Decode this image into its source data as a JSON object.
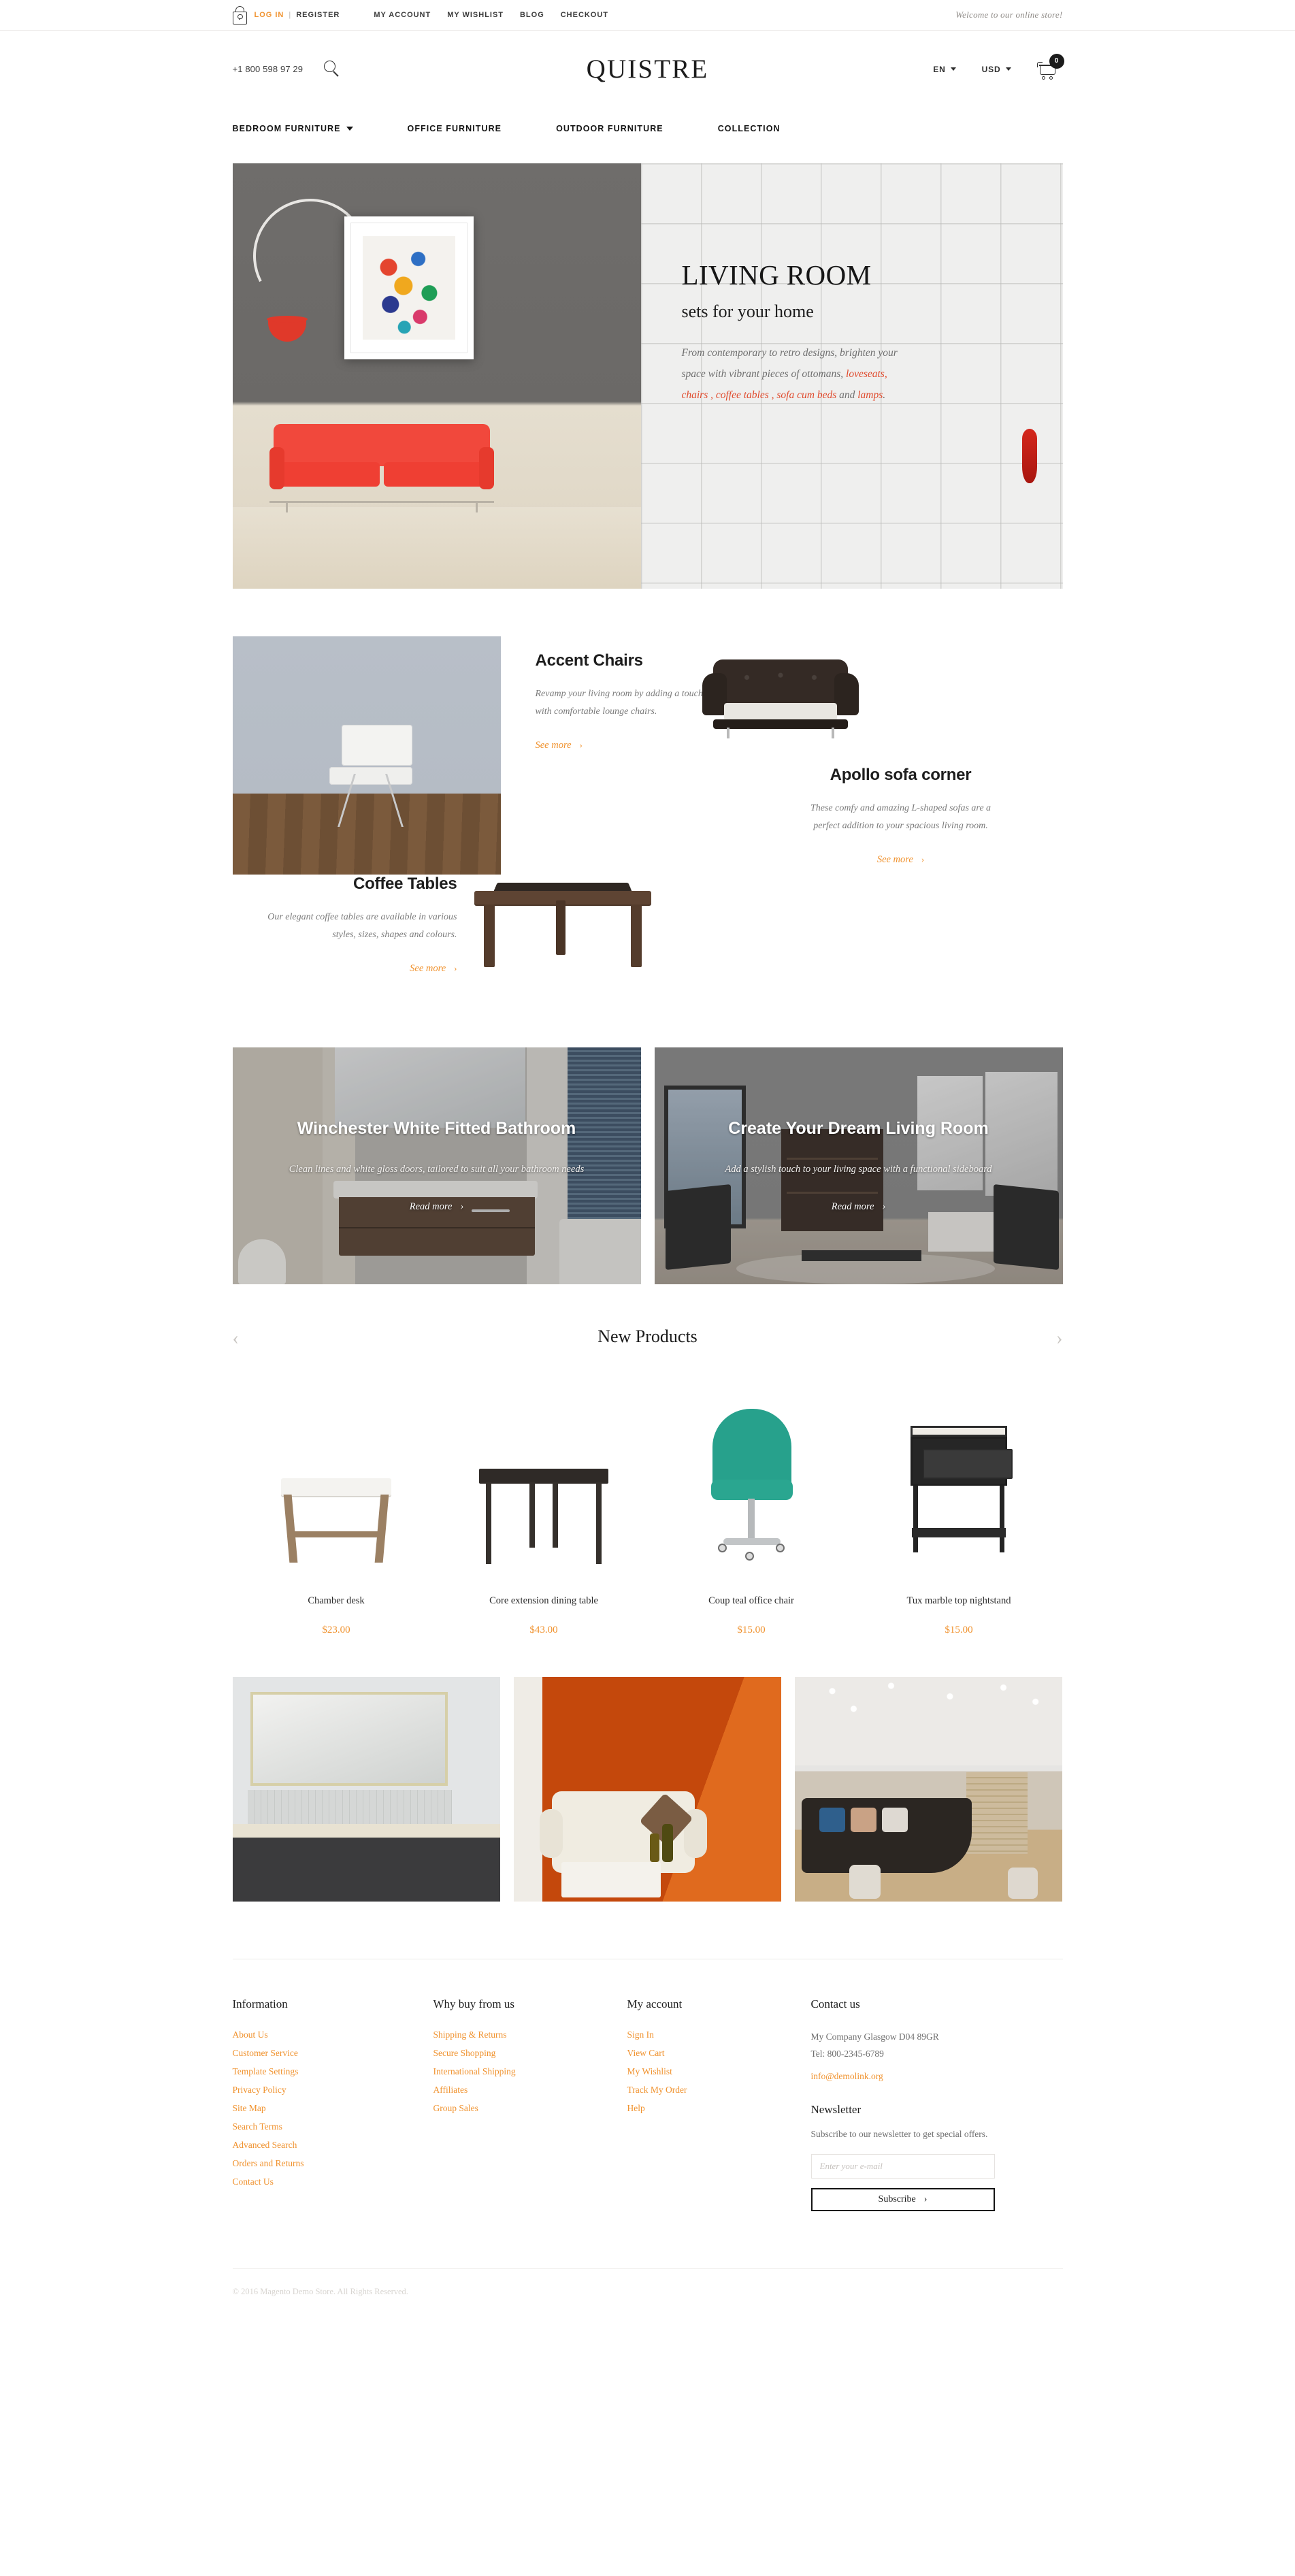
{
  "topbar": {
    "login": "LOG IN",
    "separator": "|",
    "register": "REGISTER",
    "menu": [
      "MY ACCOUNT",
      "MY WISHLIST",
      "BLOG",
      "CHECKOUT"
    ],
    "welcome": "Welcome to our online store!"
  },
  "header": {
    "phone": "+1 800 598 97 29",
    "logo": "QUISTRE",
    "language": "EN",
    "currency": "USD",
    "cart_count": "0"
  },
  "nav": {
    "items": [
      {
        "label": "BEDROOM FURNITURE",
        "has_caret": true
      },
      {
        "label": "OFFICE FURNITURE",
        "has_caret": false
      },
      {
        "label": "OUTDOOR FURNITURE",
        "has_caret": false
      },
      {
        "label": "COLLECTION",
        "has_caret": false
      }
    ]
  },
  "hero": {
    "title": "LIVING ROOM",
    "subtitle": "sets for your home",
    "text_1": "From contemporary to retro designs, brighten your space with vibrant pieces of ottomans, ",
    "text_hl_1": "loveseats, chairs , coffee tables , sofa cum beds",
    "text_2": " and ",
    "text_hl_2": "lamps",
    "text_3": "."
  },
  "categories": {
    "accent_chairs": {
      "title": "Accent Chairs",
      "text": "Revamp your living room by adding a touch of cosiness with comfortable lounge chairs.",
      "link": "See more",
      "arrow": "›"
    },
    "apollo": {
      "title": "Apollo sofa corner",
      "text": "These comfy and amazing L-shaped sofas are a perfect addition to your spacious living room.",
      "link": "See more",
      "arrow": "›"
    },
    "coffee_tables": {
      "title": "Coffee Tables",
      "text": "Our elegant coffee tables are available in various styles, sizes, shapes and colours.",
      "link": "See more",
      "arrow": "›"
    }
  },
  "promos": [
    {
      "title": "Winchester White Fitted Bathroom",
      "text": "Clean lines and white gloss doors, tailored to suit all your bathroom needs",
      "cta": "Read more",
      "arrow": "›"
    },
    {
      "title": "Create Your Dream Living Room",
      "text": "Add a stylish touch to your living space with a functional sideboard",
      "cta": "Read more",
      "arrow": "›"
    }
  ],
  "new_products": {
    "title": "New Products",
    "prev_arrow": "‹",
    "next_arrow": "›",
    "items": [
      {
        "name": "Chamber desk",
        "price": "$23.00"
      },
      {
        "name": "Core extension dining table",
        "price": "$43.00"
      },
      {
        "name": "Coup teal office chair",
        "price": "$15.00"
      },
      {
        "name": "Tux marble top nightstand",
        "price": "$15.00"
      }
    ]
  },
  "footer": {
    "col_information": {
      "heading": "Information",
      "links": [
        "About Us",
        "Customer Service",
        "Template Settings",
        "Privacy Policy",
        "Site Map",
        "Search Terms",
        "Advanced Search",
        "Orders and Returns",
        "Contact Us"
      ]
    },
    "col_why": {
      "heading": "Why buy from us",
      "links": [
        "Shipping & Returns",
        "Secure Shopping",
        "International Shipping",
        "Affiliates",
        "Group Sales"
      ]
    },
    "col_account": {
      "heading": "My account",
      "links": [
        "Sign In",
        "View Cart",
        "My Wishlist",
        "Track My Order",
        "Help"
      ]
    },
    "col_contact": {
      "heading": "Contact us",
      "address": "My Company Glasgow D04 89GR",
      "tel": "Tel: 800-2345-6789",
      "email": "info@demolink.org",
      "newsletter_heading": "Newsletter",
      "newsletter_text": "Subscribe to our newsletter to get special offers.",
      "email_placeholder": "Enter your e-mail",
      "subscribe_label": "Subscribe",
      "subscribe_arrow": "›"
    },
    "copyright": "© 2016 Magento Demo Store. All Rights Reserved."
  },
  "colors": {
    "accent": "#f0922e",
    "text_dark": "#1c1c1c",
    "text_muted": "#7b7b7b",
    "hero_highlight": "#e04a2c"
  }
}
